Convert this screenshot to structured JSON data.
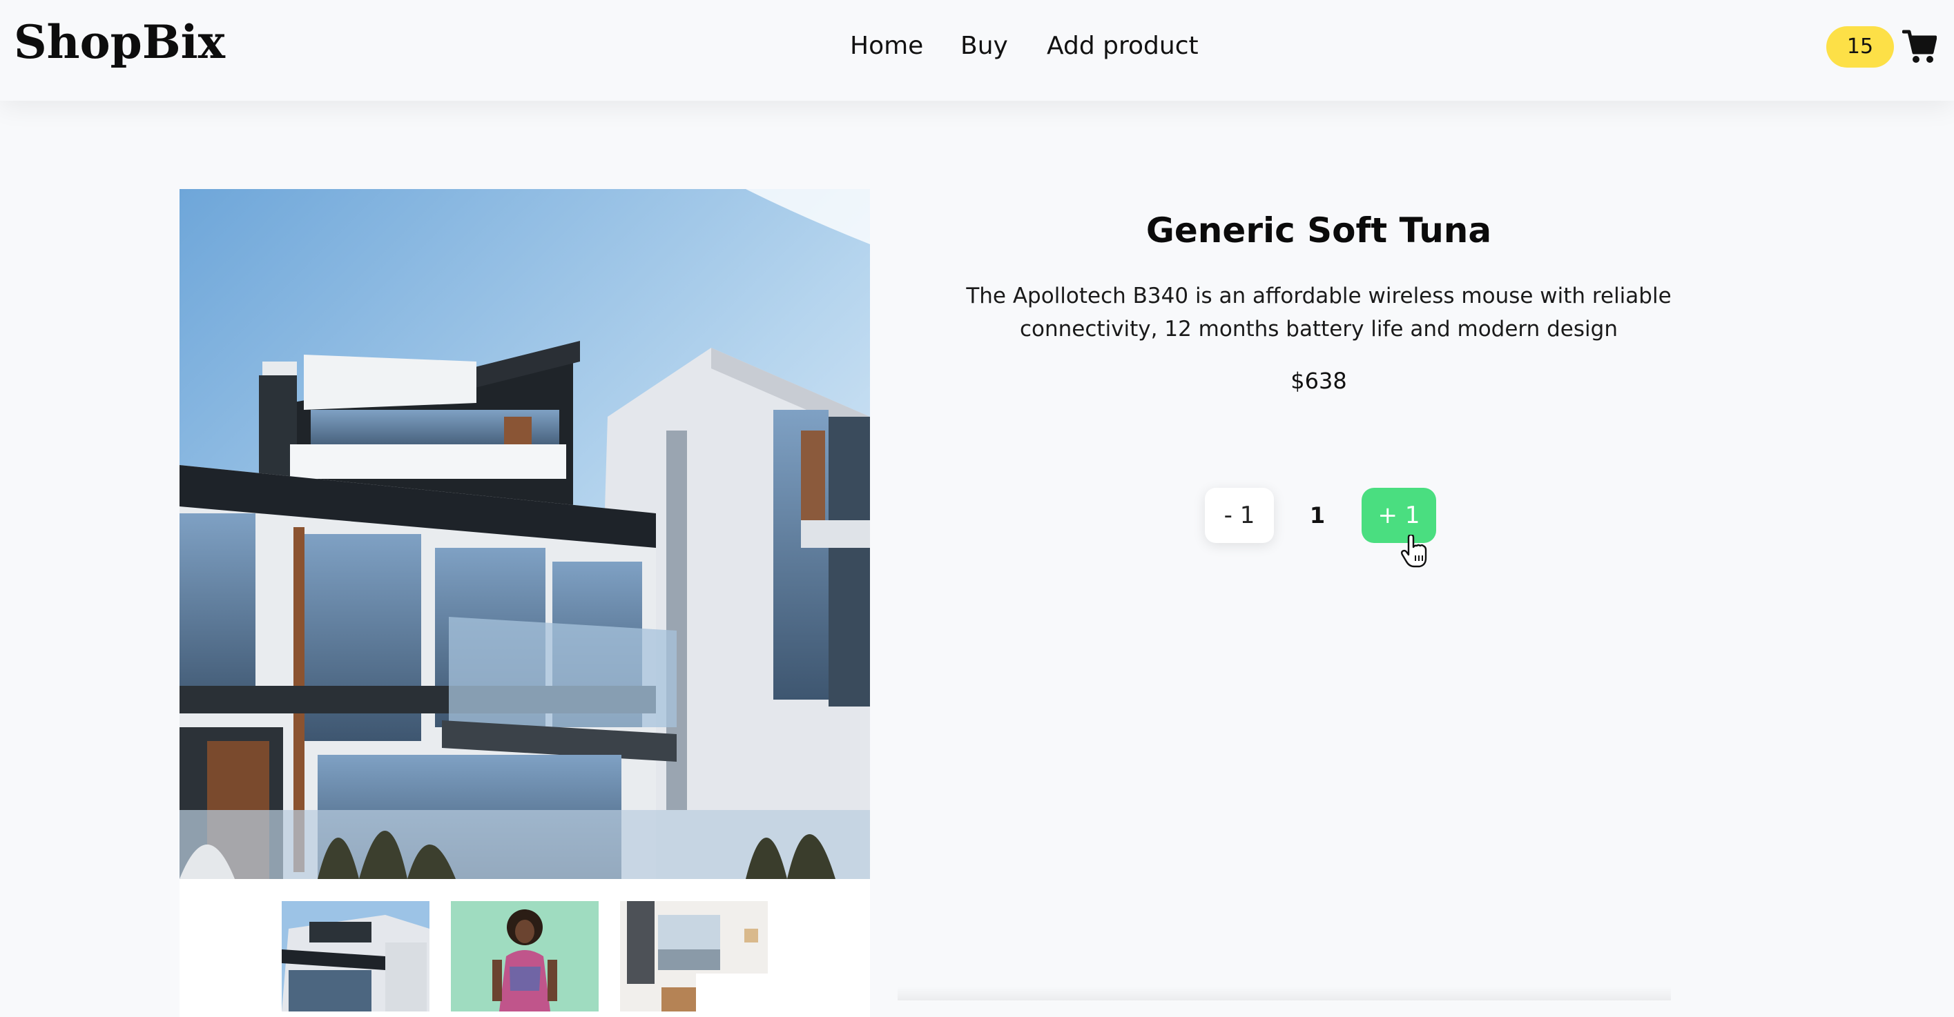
{
  "header": {
    "logo": "ShopBix",
    "nav": [
      {
        "label": "Home"
      },
      {
        "label": "Buy"
      },
      {
        "label": "Add product"
      }
    ],
    "cart_count": "15",
    "cart_icon": "cart-icon"
  },
  "product": {
    "title": "Generic Soft Tuna",
    "description": "The Apollotech B340 is an affordable wireless mouse with reliable connectivity, 12 months battery life and modern design",
    "price": "$638",
    "quantity": {
      "decrement_label": "- 1",
      "value": "1",
      "increment_label": "+ 1"
    },
    "images": {
      "main": "building-photo",
      "thumbnails": [
        "building-photo",
        "woman-photo",
        "bedroom-photo"
      ]
    }
  },
  "colors": {
    "background": "#f8f9fb",
    "badge": "#fde047",
    "increment_button": "#4ade80"
  }
}
